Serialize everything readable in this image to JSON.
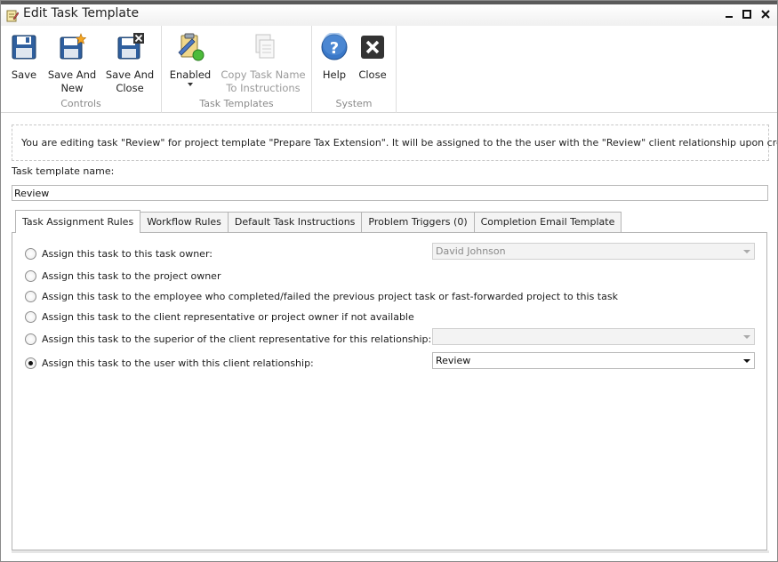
{
  "window": {
    "title": "Edit Task Template",
    "minimize": "▬",
    "maximize": "□",
    "close": "✕"
  },
  "ribbon": {
    "groups": [
      {
        "label": "Controls",
        "buttons": [
          {
            "label_1": "Save",
            "label_2": "",
            "icon": "save-icon"
          },
          {
            "label_1": "Save And",
            "label_2": "New",
            "icon": "save-and-new-icon"
          },
          {
            "label_1": "Save And",
            "label_2": "Close",
            "icon": "save-and-close-icon"
          }
        ]
      },
      {
        "label": "Task Templates",
        "buttons": [
          {
            "label_1": "Enabled",
            "label_2": "",
            "icon": "enabled-icon",
            "has_dropdown": true
          },
          {
            "label_1": "Copy Task Name",
            "label_2": "To Instructions",
            "icon": "copy-document-icon",
            "disabled": true
          }
        ]
      },
      {
        "label": "System",
        "buttons": [
          {
            "label_1": "Help",
            "label_2": "",
            "icon": "help-icon"
          },
          {
            "label_1": "Close",
            "label_2": "",
            "icon": "close-icon"
          }
        ]
      }
    ]
  },
  "info_text": "You are editing task \"Review\" for project template \"Prepare Tax Extension\". It will be assigned to the the user with the \"Review\" client relationship upon creation by default.",
  "task_name": {
    "label": "Task template name:",
    "value": "Review"
  },
  "tabs": [
    {
      "label": "Task Assignment Rules",
      "active": true
    },
    {
      "label": "Workflow Rules",
      "active": false
    },
    {
      "label": "Default Task Instructions",
      "active": false
    },
    {
      "label": "Problem Triggers (0)",
      "active": false
    },
    {
      "label": "Completion Email Template",
      "active": false
    }
  ],
  "assignment_rules": [
    {
      "label": "Assign this task to this task owner:",
      "checked": false,
      "combo_value": "David Johnson",
      "combo_enabled": false
    },
    {
      "label": "Assign this task to the project owner",
      "checked": false
    },
    {
      "label": "Assign this task to the employee who completed/failed the previous project task or fast-forwarded project to this task",
      "checked": false
    },
    {
      "label": "Assign this task to the client representative or project owner if not available",
      "checked": false
    },
    {
      "label": "Assign this task to the superior of the client representative for this relationship:",
      "checked": false,
      "combo_value": "",
      "combo_enabled": false
    },
    {
      "label": "Assign this task to the user with this client relationship:",
      "checked": true,
      "combo_value": "Review",
      "combo_enabled": true
    }
  ],
  "colors": {
    "help_blue": "#3a78c8",
    "close_dark": "#333333",
    "save_blue": "#2f5f9e"
  }
}
